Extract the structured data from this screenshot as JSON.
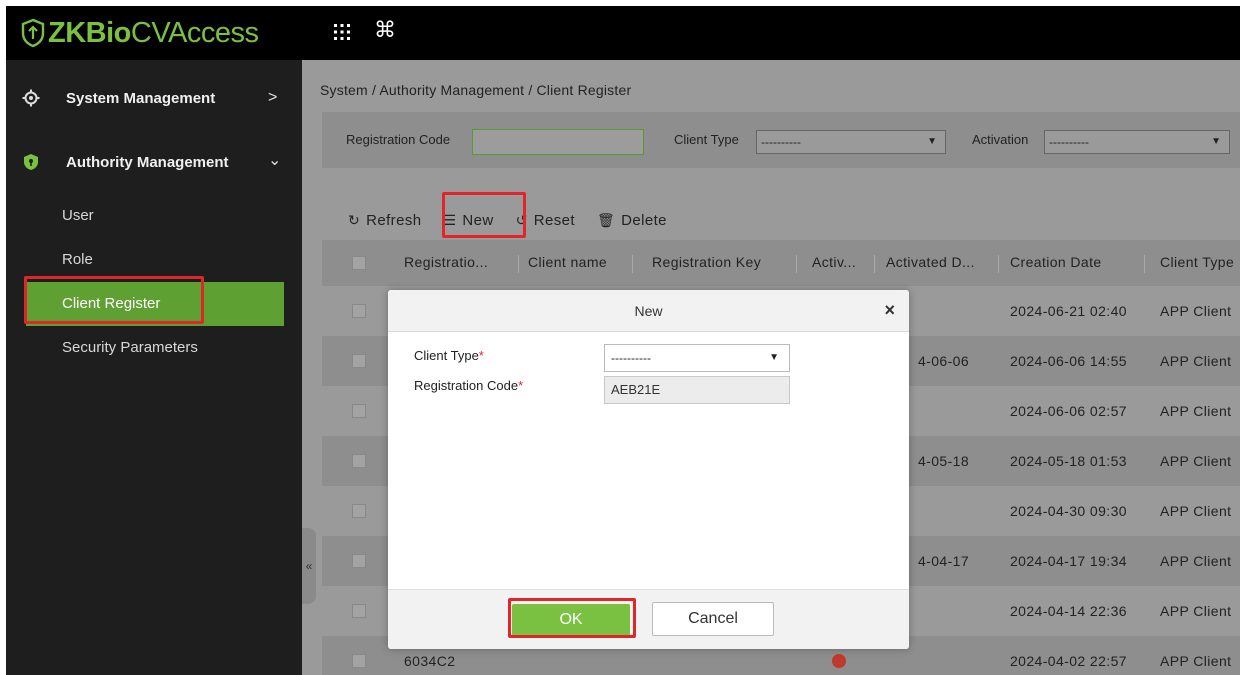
{
  "app": {
    "logo_bold": "ZKBio",
    "logo_rest": " CVAccess",
    "accent": "#7ac142",
    "highlight": "#e0262b"
  },
  "topbar": {
    "apps_icon": "grid-icon",
    "cmd_icon": "⌘"
  },
  "sidebar": {
    "groups": [
      {
        "label": "System Management",
        "icon": "gear-icon",
        "chevron": ">"
      },
      {
        "label": "Authority Management",
        "icon": "shield-icon",
        "chevron": "⌄"
      }
    ],
    "items": [
      {
        "label": "User"
      },
      {
        "label": "Role"
      },
      {
        "label": "Client Register",
        "active": true
      },
      {
        "label": "Security Parameters"
      }
    ],
    "collapse": "«"
  },
  "breadcrumb": "System / Authority Management / Client Register",
  "filter": {
    "registration_code_label": "Registration Code",
    "registration_code_value": "",
    "client_type_label": "Client Type",
    "client_type_value": "----------",
    "activation_label": "Activation",
    "activation_value": "----------"
  },
  "toolbar": {
    "refresh": "Refresh",
    "new": "New",
    "reset": "Reset",
    "delete": "Delete"
  },
  "table": {
    "columns": [
      "Registratio...",
      "Client name",
      "Registration Key",
      "Activ...",
      "Activated D...",
      "Creation Date",
      "Client Type"
    ],
    "rows": [
      {
        "code": "",
        "activated": "",
        "created": "2024-06-21 02:40",
        "type": "APP Client"
      },
      {
        "code": "",
        "activated": "4-06-06",
        "created": "2024-06-06 14:55",
        "type": "APP Client"
      },
      {
        "code": "",
        "activated": "",
        "created": "2024-06-06 02:57",
        "type": "APP Client"
      },
      {
        "code": "",
        "activated": "4-05-18",
        "created": "2024-05-18 01:53",
        "type": "APP Client"
      },
      {
        "code": "",
        "activated": "",
        "created": "2024-04-30 09:30",
        "type": "APP Client"
      },
      {
        "code": "",
        "activated": "4-04-17",
        "created": "2024-04-17 19:34",
        "type": "APP Client"
      },
      {
        "code": "",
        "activated": "",
        "created": "2024-04-14 22:36",
        "type": "APP Client"
      },
      {
        "code": "6034C2",
        "activated": "",
        "created": "2024-04-02 22:57",
        "type": "APP Client"
      }
    ]
  },
  "dialog": {
    "title": "New",
    "client_type_label": "Client Type",
    "client_type_value": "----------",
    "registration_code_label": "Registration Code",
    "registration_code_value": "AEB21E",
    "required_mark": "*",
    "ok": "OK",
    "cancel": "Cancel",
    "close": "×"
  }
}
